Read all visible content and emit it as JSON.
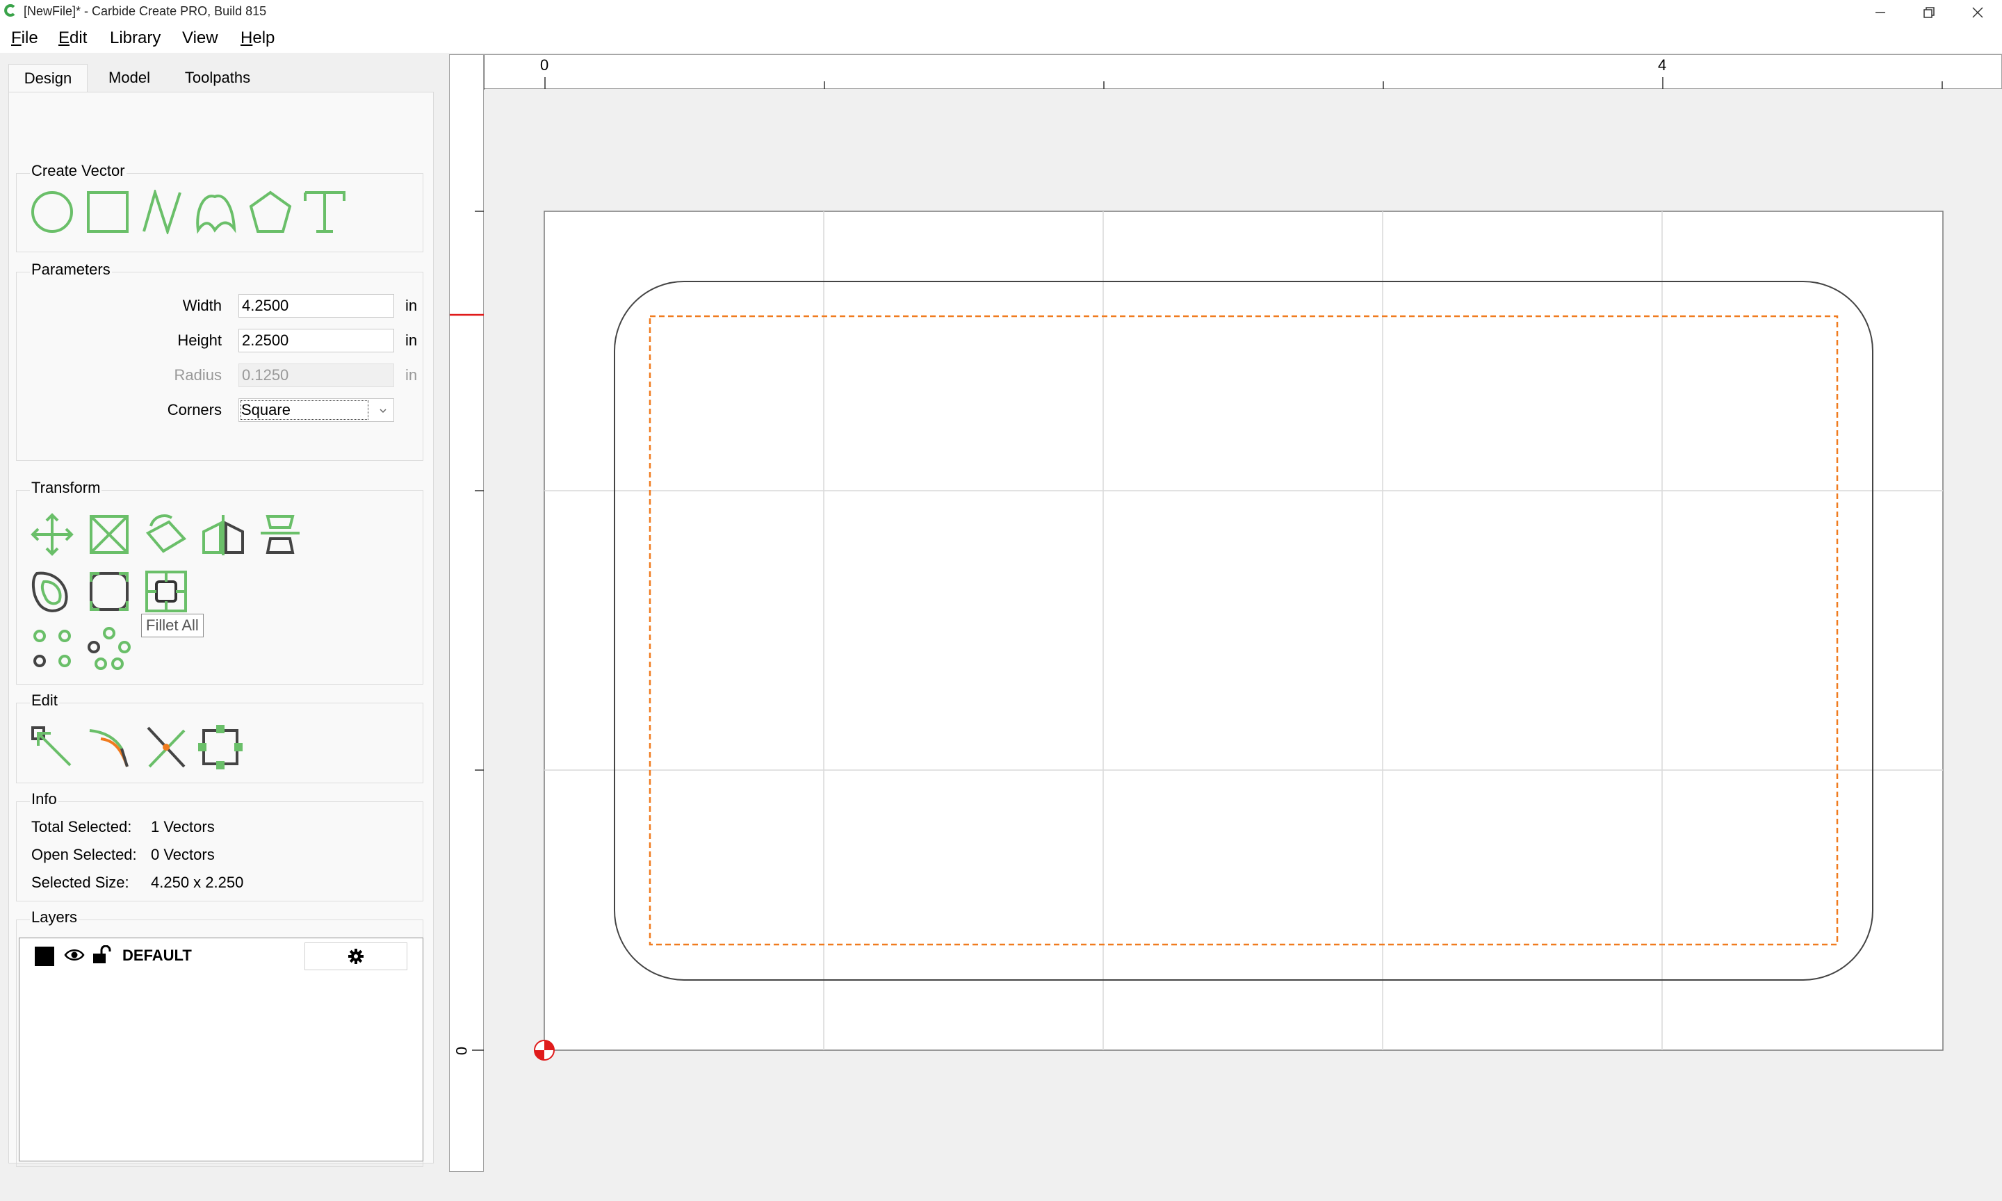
{
  "window": {
    "title": "[NewFile]* - Carbide Create PRO, Build 815",
    "logo_icon": "carbide-logo-icon",
    "controls": [
      "minimize-icon",
      "restore-icon",
      "close-icon"
    ]
  },
  "menu": {
    "items": [
      {
        "label": "File",
        "accel": "F"
      },
      {
        "label": "Edit",
        "accel": "E"
      },
      {
        "label": "Library",
        "accel": ""
      },
      {
        "label": "View",
        "accel": ""
      },
      {
        "label": "Help",
        "accel": "H"
      }
    ]
  },
  "tabs": [
    {
      "label": "Design",
      "active": true
    },
    {
      "label": "Model",
      "active": false
    },
    {
      "label": "Toolpaths",
      "active": false
    }
  ],
  "create_vector": {
    "title": "Create Vector",
    "tools": [
      "circle-icon",
      "rectangle-icon",
      "polyline-icon",
      "curve-icon",
      "polygon-icon",
      "text-icon"
    ]
  },
  "parameters": {
    "title": "Parameters",
    "width": {
      "label": "Width",
      "value": "4.2500",
      "unit": "in"
    },
    "height": {
      "label": "Height",
      "value": "2.2500",
      "unit": "in"
    },
    "radius": {
      "label": "Radius",
      "value": "0.1250",
      "unit": "in"
    },
    "corners": {
      "label": "Corners",
      "value": "Square"
    }
  },
  "transform": {
    "title": "Transform",
    "tools": [
      "move-icon",
      "scale-icon",
      "rotate-icon",
      "mirror-icon",
      "align-icon",
      "offset-icon",
      "fillet-icon",
      "fillet-all-icon",
      "array-linear-icon",
      "array-circular-icon"
    ],
    "tooltip": "Fillet All"
  },
  "edit": {
    "title": "Edit",
    "tools": [
      "node-edit-icon",
      "trim-icon",
      "cut-icon",
      "bounding-box-icon"
    ]
  },
  "info": {
    "title": "Info",
    "total_selected_label": "Total Selected:",
    "total_selected_value": "1 Vectors",
    "open_selected_label": "Open Selected:",
    "open_selected_value": "0 Vectors",
    "selected_size_label": "Selected Size:",
    "selected_size_value": "4.250 x 2.250"
  },
  "layers": {
    "title": "Layers",
    "items": [
      {
        "name": "DEFAULT",
        "color": "#000000"
      }
    ],
    "icons": [
      "eye-icon",
      "unlock-icon",
      "gear-icon"
    ]
  },
  "rulers": {
    "top_labels": [
      "0",
      "4"
    ],
    "left_labels": [
      "0"
    ]
  },
  "colors": {
    "accent_green": "#6abf69",
    "selection_orange": "#f07b1f",
    "origin_red": "#e01b1b"
  }
}
